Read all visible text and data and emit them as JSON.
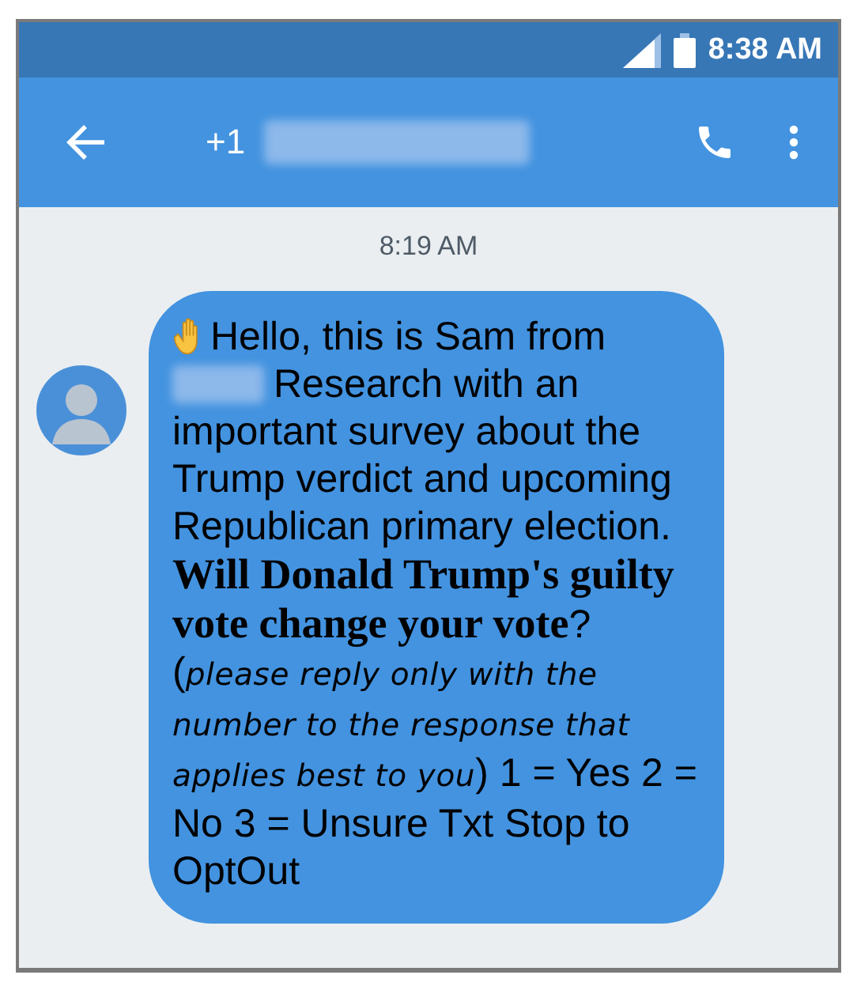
{
  "status_bar": {
    "time": "8:38 AM"
  },
  "header": {
    "title": "+1"
  },
  "conversation": {
    "timestamp": "8:19 AM",
    "message": {
      "intro": "Hello, this is Sam from",
      "line2": "Research with an",
      "body": "important survey about the Trump verdict and upcoming Republican primary election. **Will Donald Trump's guilty vote change your vote**? (*please reply only with the number to the response that applies best to you*) 1 = Yes 2 = No 3 = Unsure Txt Stop to OptOut"
    }
  }
}
